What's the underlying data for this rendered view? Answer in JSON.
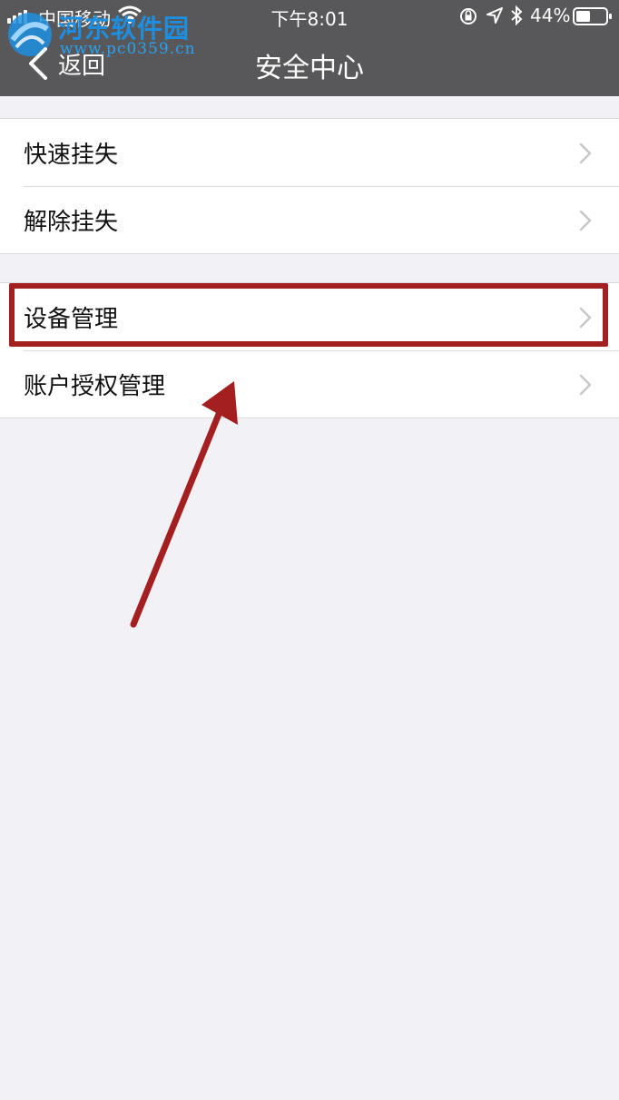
{
  "status_bar": {
    "carrier": "中国移动",
    "time": "下午8:01",
    "battery_percent": "44%",
    "icons": [
      "signal-icon",
      "wifi-icon",
      "rotation-lock-icon",
      "location-icon",
      "bluetooth-icon",
      "battery-icon"
    ]
  },
  "watermark": {
    "title": "河东软件园",
    "url": "www.pc0359.cn"
  },
  "nav": {
    "back_label": "返回",
    "title": "安全中心"
  },
  "groups": [
    {
      "items": [
        {
          "label": "快速挂失"
        },
        {
          "label": "解除挂失"
        }
      ]
    },
    {
      "items": [
        {
          "label": "设备管理"
        },
        {
          "label": "账户授权管理"
        }
      ]
    }
  ],
  "annotation": {
    "highlight_color": "#a41f1f",
    "highlighted_item": "设备管理"
  },
  "colors": {
    "header_bg": "#58585a",
    "page_bg": "#f2f1f6",
    "chevron": "#c7c7cc"
  }
}
